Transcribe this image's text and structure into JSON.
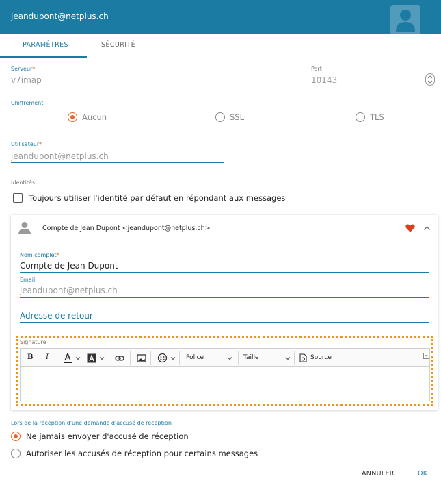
{
  "header": {
    "title": "jeandupont@netplus.ch"
  },
  "tabs": [
    {
      "label": "PARAMÈTRES"
    },
    {
      "label": "SÉCURITÉ"
    }
  ],
  "server": {
    "label": "Serveur",
    "value": "v7imap"
  },
  "port": {
    "label": "Port",
    "value": "10143"
  },
  "encryption": {
    "label": "Chiffrement",
    "options": [
      {
        "label": "Aucun",
        "selected": true
      },
      {
        "label": "SSL",
        "selected": false
      },
      {
        "label": "TLS",
        "selected": false
      }
    ]
  },
  "user": {
    "label": "Utilisateur",
    "value": "jeandupont@netplus.ch"
  },
  "identities": {
    "label": "Identités",
    "always_default_label": "Toujours utiliser l'identité par défaut en répondant aux messages"
  },
  "identity_card": {
    "header": "Compte de Jean Dupont <jeandupont@netplus.ch>",
    "fullname_label": "Nom complet",
    "fullname_value": "Compte de Jean Dupont",
    "email_label": "Email",
    "email_value": "jeandupont@netplus.ch",
    "return_address_label": "Adresse de retour",
    "signature_label": "Signature",
    "toolbar": {
      "bold": "B",
      "italic": "I",
      "font": "Police",
      "size": "Taille",
      "source": "Source"
    }
  },
  "receipt": {
    "label": "Lors de la réception d'une demande d'accusé de réception",
    "options": [
      {
        "label": "Ne jamais envoyer d'accusé de réception",
        "selected": true
      },
      {
        "label": "Autoriser les accusés de réception pour certains messages",
        "selected": false
      }
    ]
  },
  "footer": {
    "cancel": "ANNULER",
    "ok": "OK"
  },
  "colors": {
    "primary": "#1b7ba3",
    "accent": "#e36a2a",
    "highlight_border": "#f0960f",
    "favorite": "#d8401f"
  }
}
